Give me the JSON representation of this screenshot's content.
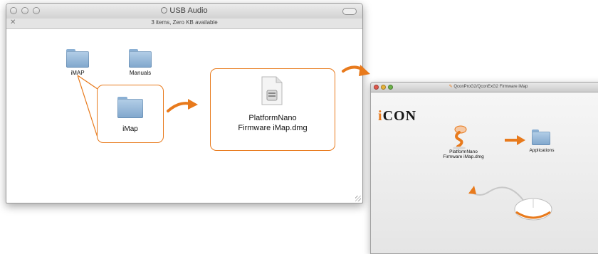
{
  "finder": {
    "title": "USB Audio",
    "status": "3 items, Zero KB available",
    "items": [
      {
        "label": "iMAP"
      },
      {
        "label": "Manuals"
      }
    ],
    "zoom_folder": {
      "label": "iMap"
    },
    "dmg": {
      "line1": "PlatformNano",
      "line2": "Firmware iMap.dmg"
    }
  },
  "installer": {
    "title": "QconProG2/QconExG2 Firmware iMap",
    "logo_prefix": "i",
    "logo_rest": "CON",
    "package": {
      "line1": "PlatformNano",
      "line2": "Firmware iMap.dmg"
    },
    "applications_label": "Applications"
  },
  "colors": {
    "accent": "#e87a1c",
    "folder_blue": "#8fb3d6",
    "light_red": "#e0584c",
    "light_yellow": "#e8b33a",
    "light_green": "#6cb24a"
  }
}
